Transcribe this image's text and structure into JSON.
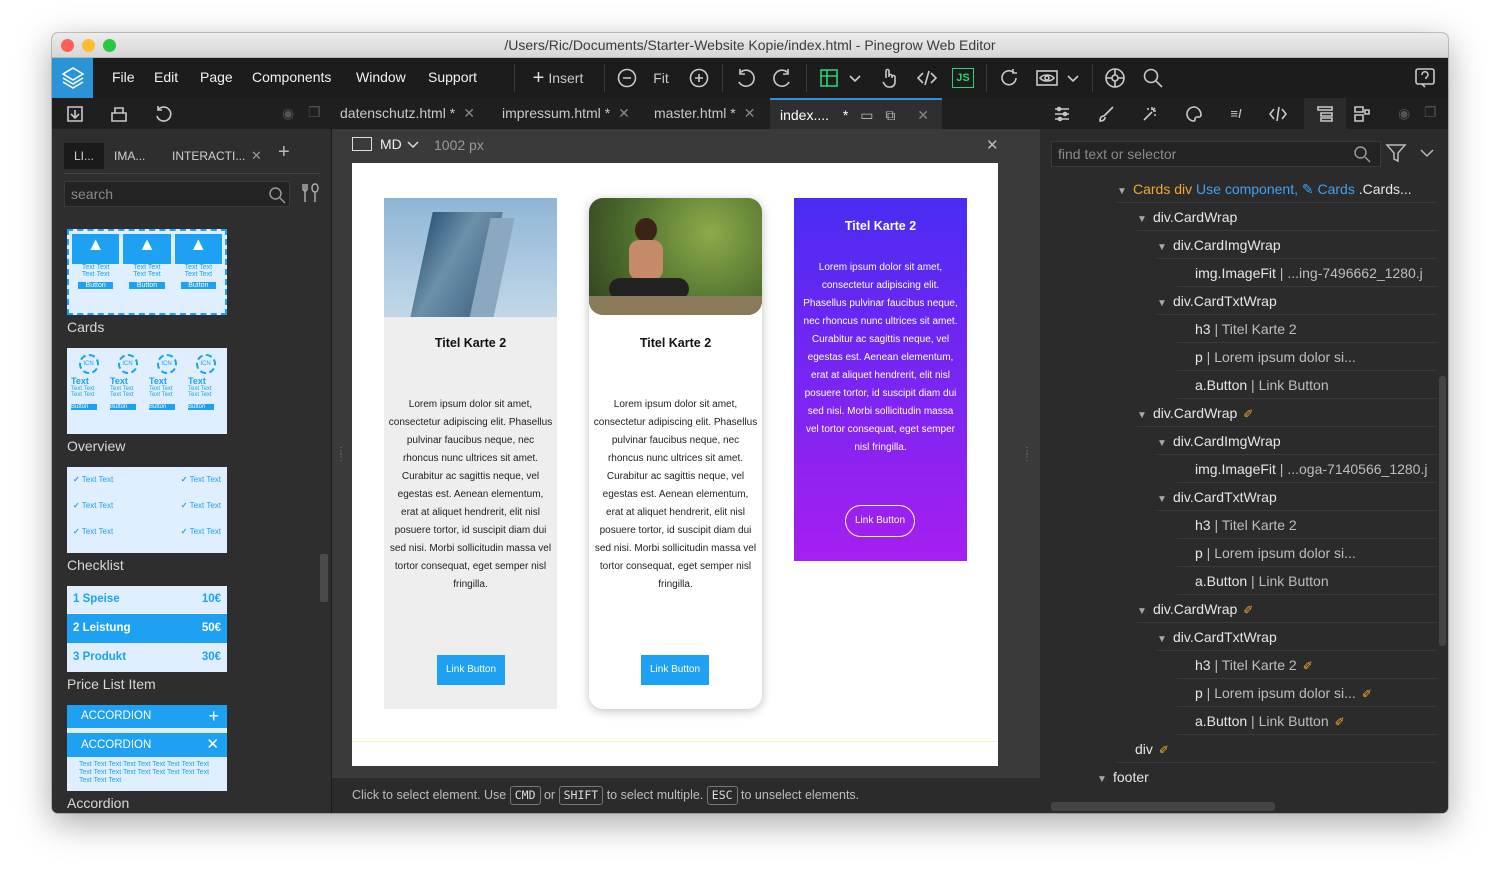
{
  "window": {
    "title": "/Users/Ric/Documents/Starter-Website Kopie/index.html - Pinegrow Web Editor"
  },
  "menu": [
    "File",
    "Edit",
    "Page",
    "Components",
    "Window",
    "Support"
  ],
  "toolbar": {
    "insert": "Insert",
    "fit": "Fit",
    "js": "JS"
  },
  "file_tabs": [
    {
      "label": "datenschutz.html",
      "mod": "*"
    },
    {
      "label": "impressum.html",
      "mod": "*"
    },
    {
      "label": "master.html",
      "mod": "*"
    },
    {
      "label": "index....",
      "mod": "*"
    }
  ],
  "left": {
    "tabs": [
      "LI...",
      "IMA...",
      "INTERACTI..."
    ],
    "search_placeholder": "search",
    "thumbs": [
      {
        "label": "Cards",
        "text": "Text Text",
        "btn": "Button"
      },
      {
        "label": "Overview",
        "icn": "ICN",
        "title": "Text",
        "text": "Text Text",
        "btn": "Button"
      },
      {
        "label": "Checklist",
        "text": "Text Text"
      },
      {
        "label": "Price List Item",
        "rows": [
          {
            "name": "1  Speise",
            "price": "10€"
          },
          {
            "name": "2  Leistung",
            "price": "50€"
          },
          {
            "name": "3  Produkt",
            "price": "30€"
          }
        ]
      },
      {
        "label": "Accordion",
        "head": "ACCORDION",
        "text": "Text Text Text Text Text Text Text Text Text Text Text Text Text Text Text Text Text Text Text Text Text"
      }
    ]
  },
  "canvas": {
    "size": "MD",
    "width": "1002 px",
    "cards": [
      {
        "title": "Titel Karte 2",
        "text": "Lorem ipsum dolor sit amet, consectetur adipiscing elit. Phasellus pulvinar faucibus neque, nec rhoncus nunc ultrices sit amet. Curabitur ac sagittis neque, vel egestas est. Aenean elementum, erat at aliquet hendrerit, elit nisl posuere tortor, id suscipit diam dui sed nisi. Morbi sollicitudin massa vel tortor consequat, eget semper nisl fringilla.",
        "button": "Link Button"
      },
      {
        "title": "Titel Karte 2",
        "text": "Lorem ipsum dolor sit amet, consectetur adipiscing elit. Phasellus pulvinar faucibus neque, nec rhoncus nunc ultrices sit amet. Curabitur ac sagittis neque, vel egestas est. Aenean elementum, erat at aliquet hendrerit, elit nisl posuere tortor, id suscipit diam dui sed nisi. Morbi sollicitudin massa vel tortor consequat, eget semper nisl fringilla.",
        "button": "Link Button"
      },
      {
        "title": "Titel Karte 2",
        "text": "Lorem ipsum dolor sit amet, consectetur adipiscing elit. Phasellus pulvinar faucibus neque, nec rhoncus nunc ultrices sit amet. Curabitur ac sagittis neque, vel egestas est. Aenean elementum, erat at aliquet hendrerit, elit nisl posuere tortor, id suscipit diam dui sed nisi. Morbi sollicitudin massa vel tortor consequat, eget semper nisl fringilla.",
        "button": "Link Button"
      }
    ]
  },
  "status": {
    "a": "Click to select element. Use",
    "cmd": "CMD",
    "or": "or",
    "shift": "SHIFT",
    "b": "to select multiple.",
    "esc": "ESC",
    "c": "to unselect elements."
  },
  "right": {
    "find_placeholder": "find text or selector",
    "tree": [
      {
        "tag": "Cards div",
        "use": "Use component,",
        "comp": "Cards",
        "rest": ".Cards..."
      },
      {
        "tag": "div.CardWrap"
      },
      {
        "tag": "div.CardImgWrap"
      },
      {
        "tag": "img.ImageFit",
        "sep": " | ",
        "dim": "...ing-7496662_1280.j"
      },
      {
        "tag": "div.CardTxtWrap"
      },
      {
        "tag": "h3",
        "sep": " | ",
        "dim": "Titel Karte 2"
      },
      {
        "tag": "p",
        "sep": " | ",
        "dim": "Lorem ipsum dolor si..."
      },
      {
        "tag": "a.Button",
        "sep": " | ",
        "dim": "Link Button"
      },
      {
        "tag": "div.CardWrap"
      },
      {
        "tag": "div.CardImgWrap"
      },
      {
        "tag": "img.ImageFit",
        "sep": " | ",
        "dim": "...oga-7140566_1280.j"
      },
      {
        "tag": "div.CardTxtWrap"
      },
      {
        "tag": "h3",
        "sep": " | ",
        "dim": "Titel Karte 2"
      },
      {
        "tag": "p",
        "sep": " | ",
        "dim": "Lorem ipsum dolor si..."
      },
      {
        "tag": "a.Button",
        "sep": " | ",
        "dim": "Link Button"
      },
      {
        "tag": "div.CardWrap"
      },
      {
        "tag": "div.CardTxtWrap"
      },
      {
        "tag": "h3",
        "sep": " | ",
        "dim": "Titel Karte 2"
      },
      {
        "tag": "p",
        "sep": " | ",
        "dim": "Lorem ipsum dolor si..."
      },
      {
        "tag": "a.Button",
        "sep": " | ",
        "dim": "Link Button"
      },
      {
        "tag": "div"
      },
      {
        "tag": "footer"
      }
    ]
  },
  "colors": {
    "accent": "#2a94d6",
    "button": "#1ea1f2",
    "purple_top": "#4a2cf2",
    "purple_bottom": "#a61ff0",
    "orange": "#f0a830"
  }
}
